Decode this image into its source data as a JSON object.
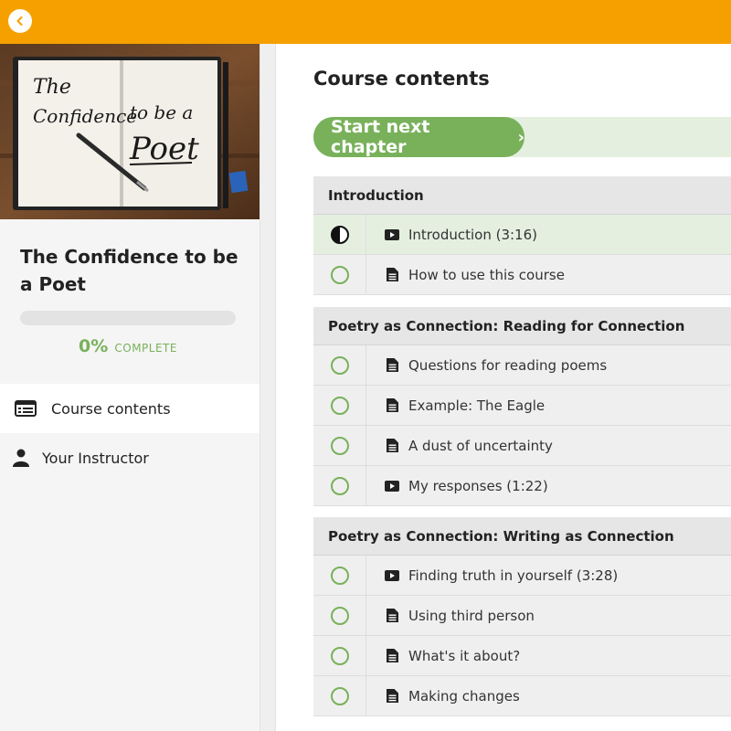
{
  "course": {
    "title": "The Confidence to be a Poet",
    "progress_percent": 0,
    "progress_pct_text": "0%",
    "progress_label": "COMPLETE"
  },
  "cover": {
    "line1": "The",
    "line2": "Confidence",
    "line3": "to be a",
    "line4": "Poet"
  },
  "nav": [
    {
      "label": "Course contents",
      "icon": "list-icon",
      "active": true
    },
    {
      "label": "Your Instructor",
      "icon": "user-icon",
      "active": false
    }
  ],
  "main": {
    "title": "Course contents",
    "next_button": "Start next chapter",
    "next_chevron": "›"
  },
  "sections": [
    {
      "title": "Introduction",
      "lessons": [
        {
          "label": "Introduction (3:16)",
          "type": "video-icon",
          "status": "in-progress"
        },
        {
          "label": "How to use this course",
          "type": "document-icon",
          "status": "not-started"
        }
      ]
    },
    {
      "title": "Poetry as Connection: Reading for Connection",
      "lessons": [
        {
          "label": "Questions for reading poems",
          "type": "document-icon",
          "status": "not-started"
        },
        {
          "label": "Example: The Eagle",
          "type": "document-icon",
          "status": "not-started"
        },
        {
          "label": "A dust of uncertainty",
          "type": "document-icon",
          "status": "not-started"
        },
        {
          "label": "My responses (1:22)",
          "type": "video-icon",
          "status": "not-started"
        }
      ]
    },
    {
      "title": "Poetry as Connection: Writing as Connection",
      "lessons": [
        {
          "label": "Finding truth in yourself (3:28)",
          "type": "video-icon",
          "status": "not-started"
        },
        {
          "label": "Using third person",
          "type": "document-icon",
          "status": "not-started"
        },
        {
          "label": "What's it about?",
          "type": "document-icon",
          "status": "not-started"
        },
        {
          "label": "Making changes",
          "type": "document-icon",
          "status": "not-started"
        }
      ]
    }
  ],
  "colors": {
    "accent_orange": "#f6a000",
    "accent_green": "#78b15a",
    "current_row": "#e4efe0"
  }
}
